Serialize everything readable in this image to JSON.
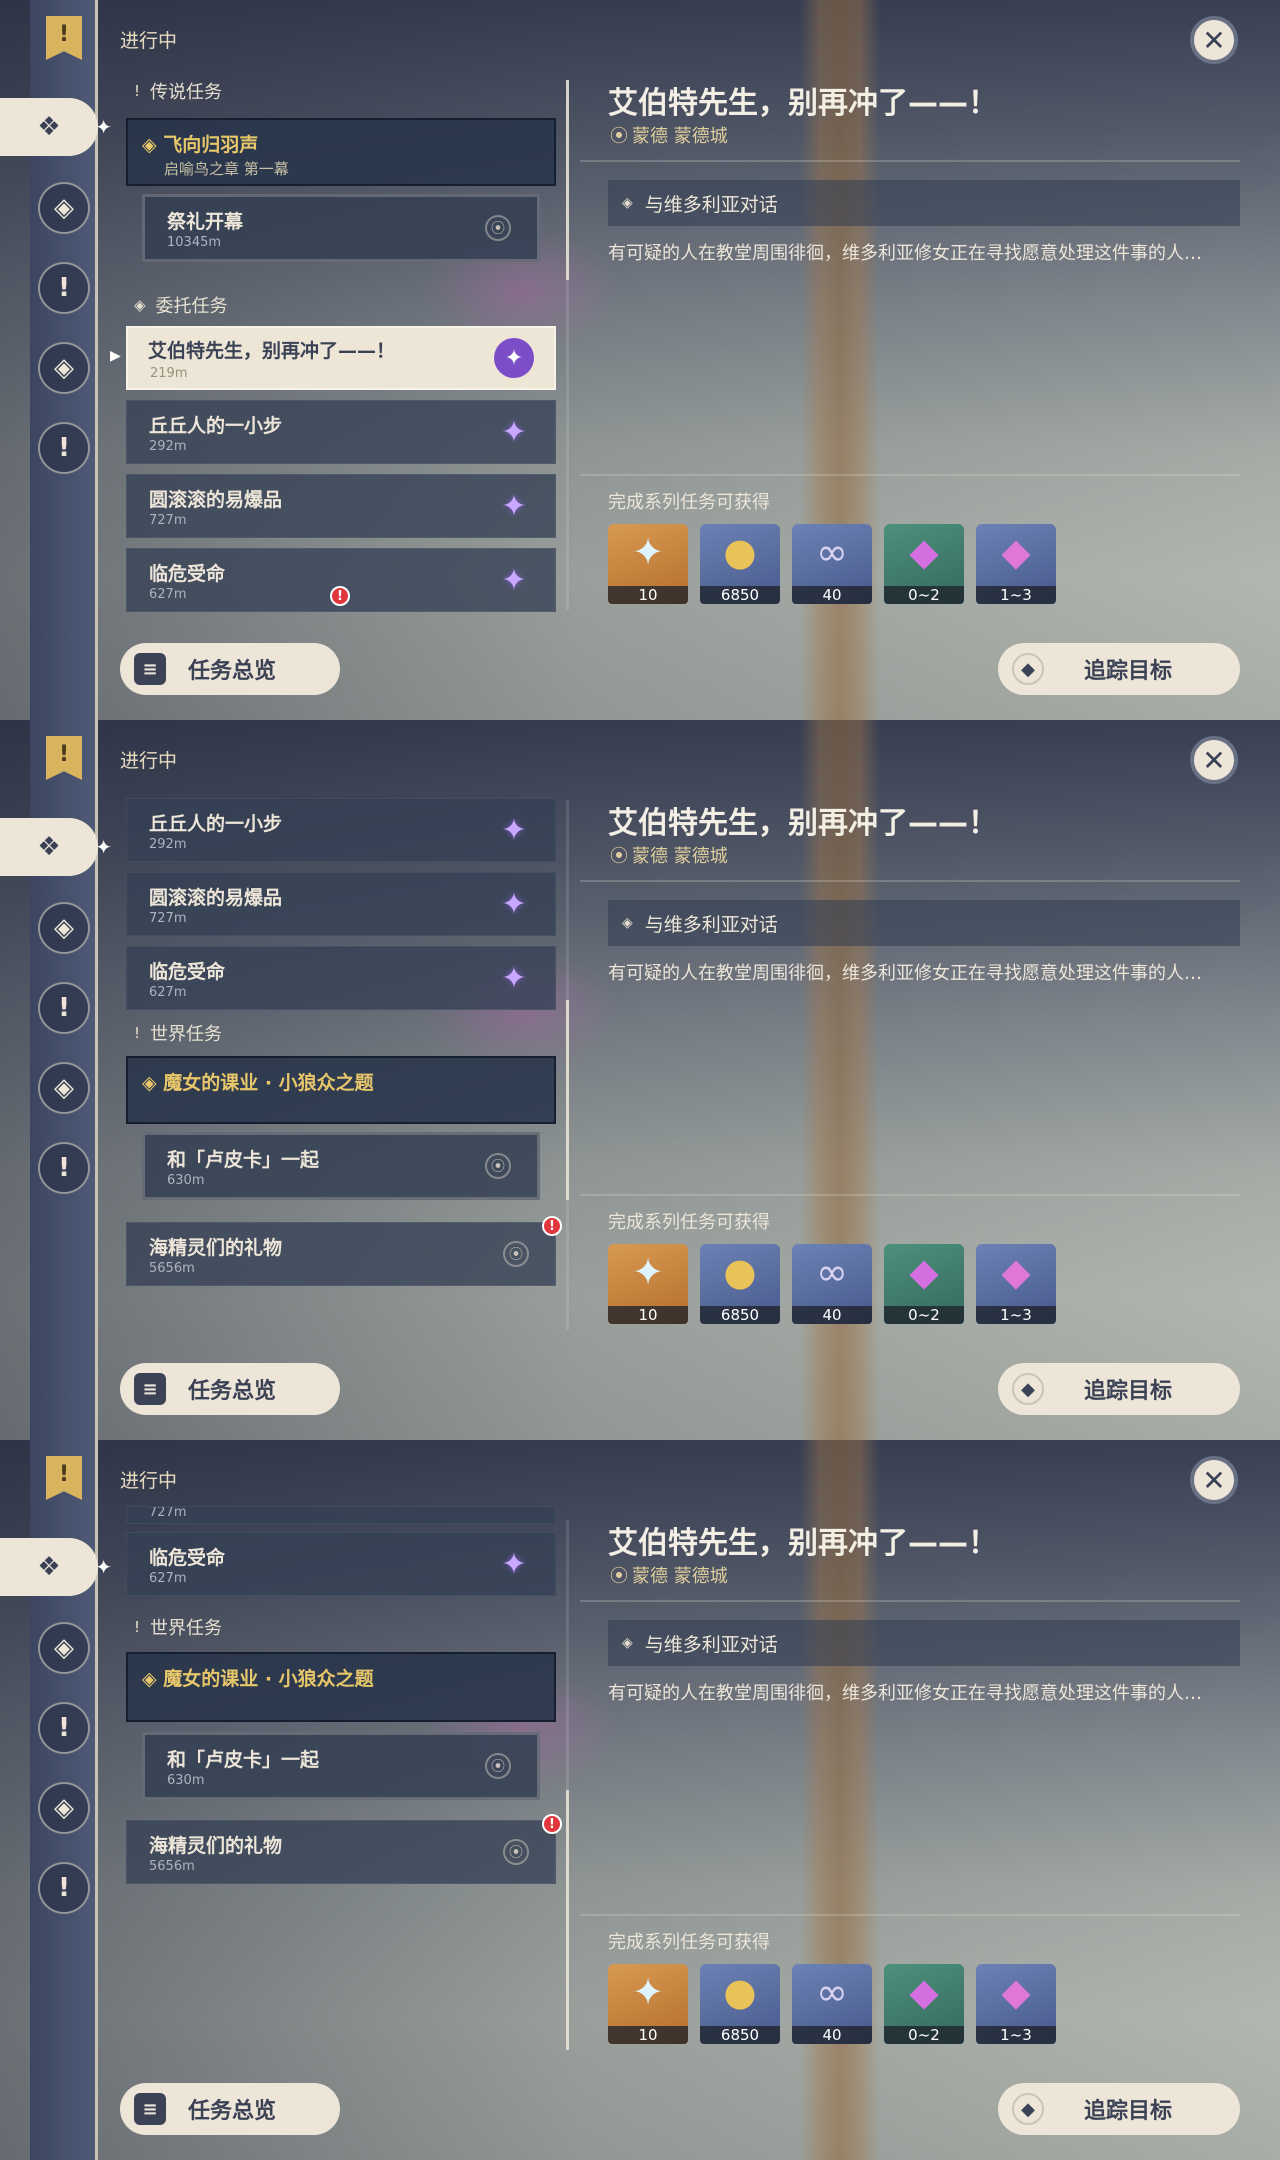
{
  "nav": {
    "flag_glyph": "!",
    "items": [
      {
        "icon": "diamond-cluster-icon",
        "glyph": "❖",
        "active": true
      },
      {
        "icon": "legend-quest-icon",
        "glyph": "◈",
        "active": false
      },
      {
        "icon": "world-quest-icon",
        "glyph": "!",
        "active": false
      },
      {
        "icon": "commission-icon",
        "glyph": "◈",
        "active": false
      },
      {
        "icon": "exclamation-icon",
        "glyph": "!",
        "active": false
      }
    ]
  },
  "section_title": "进行中",
  "categories": {
    "legend": "传说任务",
    "commission": "委托任务",
    "world": "世界任务"
  },
  "quests": {
    "legend_main": {
      "name": "飞向归羽声",
      "sub": "启喻鸟之章 第一幕"
    },
    "legend_sub": {
      "name": "祭礼开幕",
      "dist": "10345m"
    },
    "c1": {
      "name": "艾伯特先生，别再冲了——！",
      "dist": "219m"
    },
    "c2": {
      "name": "丘丘人的一小步",
      "dist": "292m"
    },
    "c3": {
      "name": "圆滚滚的易爆品",
      "dist": "727m"
    },
    "c4": {
      "name": "临危受命",
      "dist": "627m"
    },
    "world_main": {
      "name": "魔女的课业 · 小狼众之题"
    },
    "world_sub": {
      "name": "和「卢皮卡」一起",
      "dist": "630m"
    },
    "world2": {
      "name": "海精灵们的礼物",
      "dist": "5656m"
    },
    "partial_dist": "727m"
  },
  "buttons": {
    "overview": "任务总览",
    "track": "追踪目标",
    "close_glyph": "✕"
  },
  "detail": {
    "title": "艾伯特先生，别再冲了——！",
    "location": "蒙德 蒙德城",
    "objective": "与维多利亚对话",
    "description": "有可疑的人在教堂周围徘徊，维多利亚修女正在寻找愿意处理这件事的人…",
    "rewards_label": "完成系列任务可获得",
    "rewards": [
      {
        "icon": "primogem-icon",
        "glyph": "✦",
        "value": "10",
        "color": "#c4843e"
      },
      {
        "icon": "mora-icon",
        "glyph": "●",
        "value": "6850",
        "color": "#5a6d9e"
      },
      {
        "icon": "adventure-exp-icon",
        "glyph": "∞",
        "value": "40",
        "color": "#5a6d9e"
      },
      {
        "icon": "crystal-chunk-icon",
        "glyph": "◆",
        "value": "0~2",
        "color": "#3f7c6b"
      },
      {
        "icon": "crystal-cluster-icon",
        "glyph": "◆",
        "value": "1~3",
        "color": "#5a6d9e"
      }
    ]
  }
}
